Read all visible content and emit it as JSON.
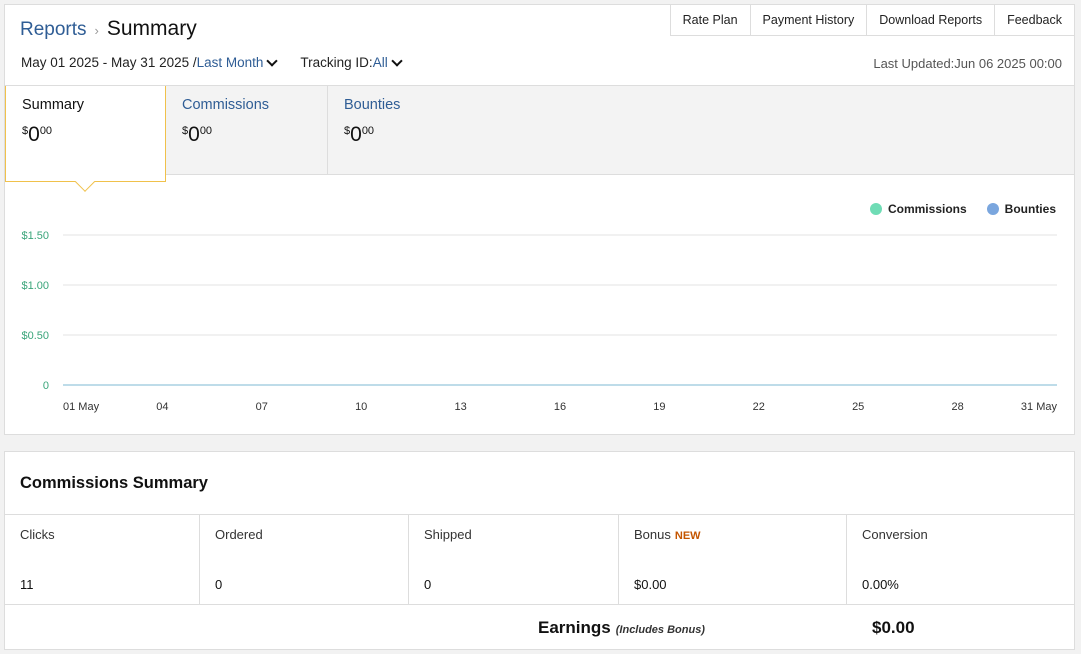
{
  "breadcrumb": {
    "parent": "Reports",
    "separator": "›",
    "current": "Summary"
  },
  "topnav": [
    "Rate Plan",
    "Payment History",
    "Download Reports",
    "Feedback"
  ],
  "filters": {
    "date_range": "May 01 2025 - May 31 2025 /",
    "period": "Last Month",
    "tracking_label": "Tracking ID:",
    "tracking_value": "All"
  },
  "last_updated": "Last Updated:Jun 06 2025 00:00",
  "tabs": [
    {
      "label": "Summary",
      "currency": "$",
      "whole": "0",
      "cents": "00"
    },
    {
      "label": "Commissions",
      "currency": "$",
      "whole": "0",
      "cents": "00"
    },
    {
      "label": "Bounties",
      "currency": "$",
      "whole": "0",
      "cents": "00"
    }
  ],
  "legend": [
    {
      "name": "Commissions",
      "color": "#6fdcb5"
    },
    {
      "name": "Bounties",
      "color": "#7aa6de"
    }
  ],
  "chart_data": {
    "type": "line",
    "categories": [
      "01 May",
      "04",
      "07",
      "10",
      "13",
      "16",
      "19",
      "22",
      "25",
      "28",
      "31 May"
    ],
    "y_ticks": [
      "$1.50",
      "$1.00",
      "$0.50",
      "0"
    ],
    "ylim": [
      0,
      1.5
    ],
    "series": [
      {
        "name": "Commissions",
        "values": [
          0,
          0,
          0,
          0,
          0,
          0,
          0,
          0,
          0,
          0,
          0
        ]
      },
      {
        "name": "Bounties",
        "values": [
          0,
          0,
          0,
          0,
          0,
          0,
          0,
          0,
          0,
          0,
          0
        ]
      }
    ],
    "grid": true,
    "legend_position": "top-right"
  },
  "commissions_summary": {
    "title": "Commissions Summary",
    "columns": [
      {
        "header": "Clicks",
        "value": "11"
      },
      {
        "header": "Ordered",
        "value": "0"
      },
      {
        "header": "Shipped",
        "value": "0"
      },
      {
        "header": "Bonus",
        "badge": "NEW",
        "value": "$0.00"
      },
      {
        "header": "Conversion",
        "value": "0.00%"
      }
    ],
    "earnings_label": "Earnings",
    "earnings_note": "(Includes Bonus)",
    "earnings_value": "$0.00"
  }
}
